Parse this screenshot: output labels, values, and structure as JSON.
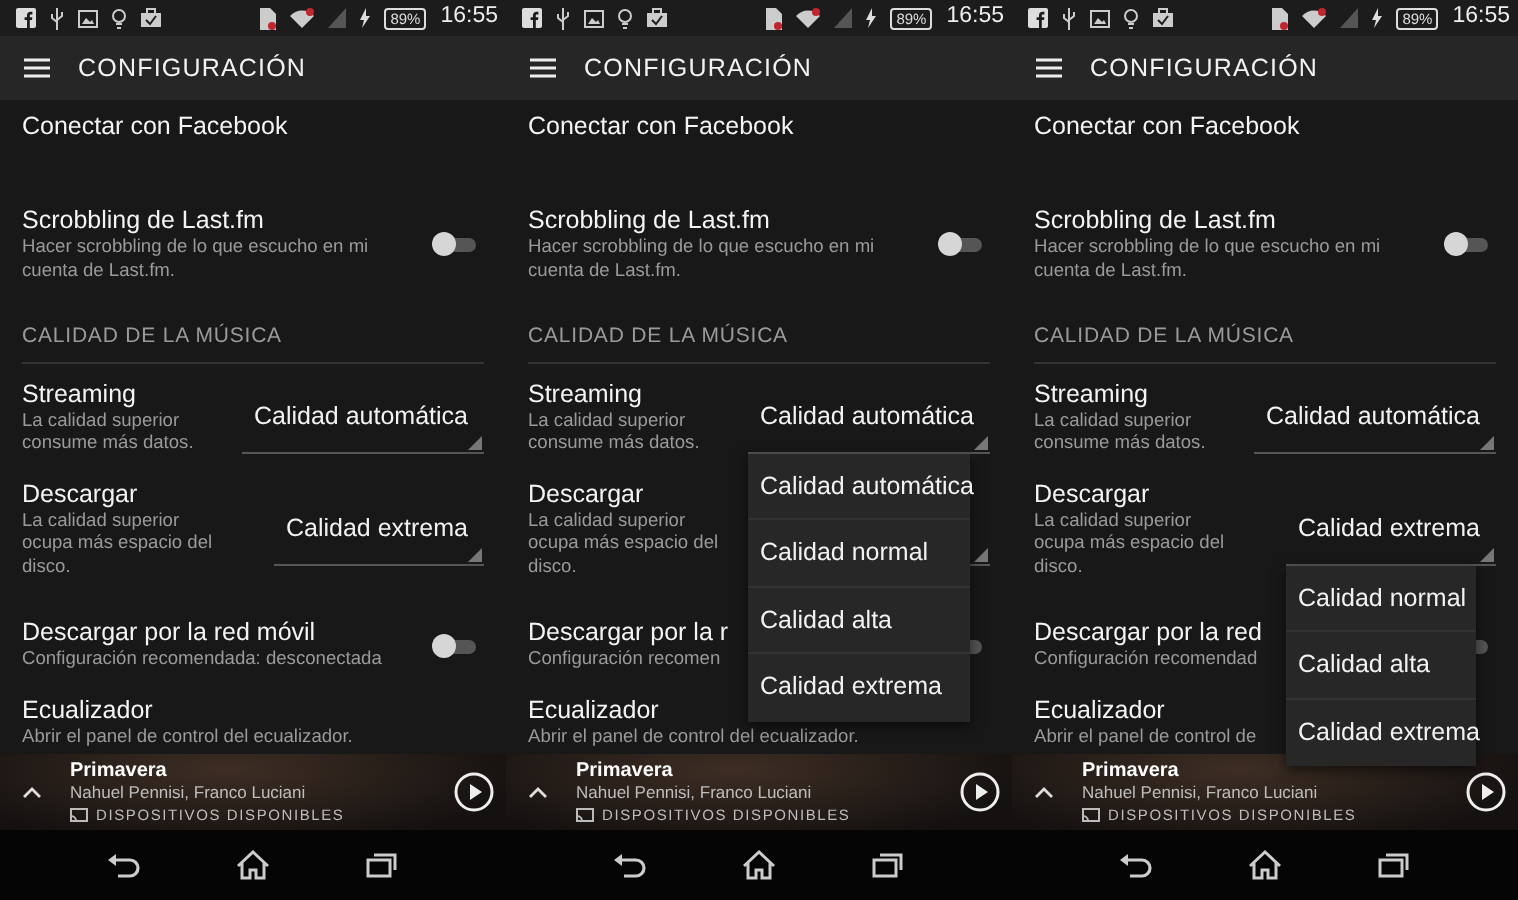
{
  "screens": [
    {
      "status_bar": {
        "battery": "89%",
        "time": "16:55"
      },
      "app_bar": {
        "title": "CONFIGURACIÓN"
      },
      "settings": [
        {
          "kind": "link",
          "title": "Conectar con Facebook"
        },
        {
          "kind": "toggle",
          "title": "Scrobbling de Last.fm",
          "subtitle": "Hacer scrobbling de lo que escucho en mi cuenta de Last.fm.",
          "on": false
        },
        {
          "kind": "header",
          "title": "CALIDAD DE LA MÚSICA"
        },
        {
          "kind": "select",
          "title": "Streaming",
          "subtitle": "La calidad superior consume más datos.",
          "value": "Calidad automática"
        },
        {
          "kind": "select",
          "title": "Descargar",
          "subtitle": "La calidad superior ocupa más espacio del disco.",
          "value": "Calidad extrema"
        },
        {
          "kind": "toggle",
          "title": "Descargar por la red móvil",
          "subtitle": "Configuración recomendada: desconectada",
          "on": false
        },
        {
          "kind": "link",
          "title": "Ecualizador",
          "subtitle": "Abrir el panel de control del ecualizador."
        }
      ],
      "player": {
        "track": "Primavera",
        "artist": "Nahuel Pennisi, Franco Luciani",
        "devices": "DISPOSITIVOS DISPONIBLES"
      }
    },
    {
      "status_bar": {
        "battery": "89%",
        "time": "16:55"
      },
      "app_bar": {
        "title": "CONFIGURACIÓN"
      },
      "settings": [
        {
          "kind": "link",
          "title": "Conectar con Facebook"
        },
        {
          "kind": "toggle",
          "title": "Scrobbling de Last.fm",
          "subtitle": "Hacer scrobbling de lo que escucho en mi cuenta de Last.fm.",
          "on": false
        },
        {
          "kind": "header",
          "title": "CALIDAD DE LA MÚSICA"
        },
        {
          "kind": "select",
          "title": "Streaming",
          "subtitle": "La calidad superior consume más datos.",
          "value": "Calidad automática",
          "options": [
            "Calidad automática",
            "Calidad normal",
            "Calidad alta",
            "Calidad extrema"
          ]
        },
        {
          "kind": "select",
          "title": "Descargar",
          "subtitle": "La calidad superior ocupa más espacio del disco."
        },
        {
          "kind": "toggle",
          "title": "Descargar por la r",
          "subtitle": "Configuración recomen",
          "on": false
        },
        {
          "kind": "link",
          "title": "Ecualizador",
          "subtitle": "Abrir el panel de control del ecualizador."
        }
      ],
      "player": {
        "track": "Primavera",
        "artist": "Nahuel Pennisi, Franco Luciani",
        "devices": "DISPOSITIVOS DISPONIBLES"
      }
    },
    {
      "status_bar": {
        "battery": "89%",
        "time": "16:55"
      },
      "app_bar": {
        "title": "CONFIGURACIÓN"
      },
      "settings": [
        {
          "kind": "link",
          "title": "Conectar con Facebook"
        },
        {
          "kind": "toggle",
          "title": "Scrobbling de Last.fm",
          "subtitle": "Hacer scrobbling de lo que escucho en mi cuenta de Last.fm.",
          "on": false
        },
        {
          "kind": "header",
          "title": "CALIDAD DE LA MÚSICA"
        },
        {
          "kind": "select",
          "title": "Streaming",
          "subtitle": "La calidad superior consume más datos.",
          "value": "Calidad automática"
        },
        {
          "kind": "select",
          "title": "Descargar",
          "subtitle": "La calidad superior ocupa más espacio del disco.",
          "value": "Calidad extrema",
          "options": [
            "Calidad normal",
            "Calidad alta",
            "Calidad extrema"
          ]
        },
        {
          "kind": "toggle",
          "title": "Descargar por la red",
          "subtitle": "Configuración recomendad",
          "on": false
        },
        {
          "kind": "link",
          "title": "Ecualizador",
          "subtitle": "Abrir el panel de control de"
        }
      ],
      "player": {
        "track": "Primavera",
        "artist": "Nahuel Pennisi, Franco Luciani",
        "devices": "DISPOSITIVOS DISPONIBLES"
      }
    }
  ]
}
